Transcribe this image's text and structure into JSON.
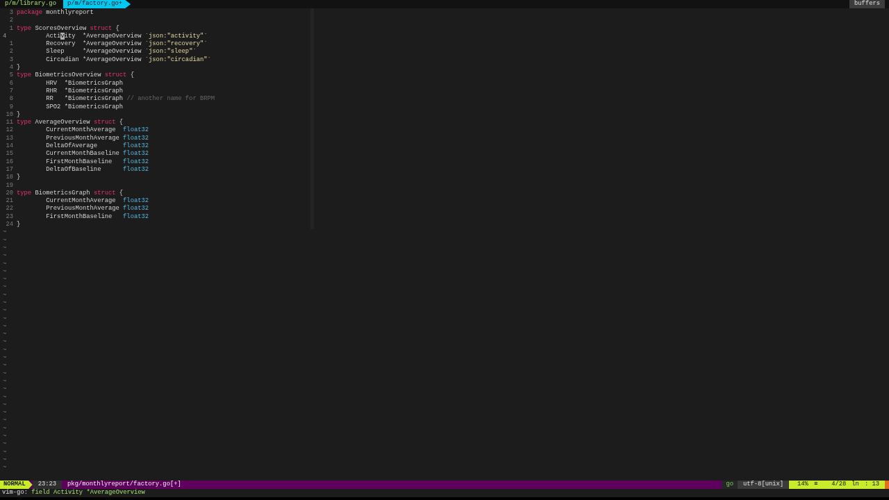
{
  "tabline": {
    "tabs": [
      {
        "label": "p/m/library.go",
        "selected": false
      },
      {
        "label": "p/m/factory.go+",
        "selected": true
      }
    ],
    "buffers_label": "buffers"
  },
  "lines": [
    {
      "number": "3",
      "current": false,
      "tokens": [
        {
          "kind": "keyword",
          "text": "package"
        },
        {
          "kind": "plain",
          "text": " monthlyreport"
        }
      ]
    },
    {
      "number": "2",
      "current": false
    },
    {
      "number": "1",
      "current": false,
      "tokens": [
        {
          "kind": "keyword",
          "text": "type"
        },
        {
          "kind": "plain",
          "text": " ScoresOverview "
        },
        {
          "kind": "keyword",
          "text": "struct"
        },
        {
          "kind": "plain",
          "text": " {"
        }
      ]
    },
    {
      "number": "4",
      "current": true,
      "tokens": [
        {
          "kind": "plain",
          "text": "\tActi"
        },
        {
          "kind": "cursor",
          "text": "v"
        },
        {
          "kind": "plain",
          "text": "ity  *AverageOverview "
        },
        {
          "kind": "string",
          "text": "`json:\"activity\"`"
        }
      ]
    },
    {
      "number": "1",
      "current": false,
      "tokens": [
        {
          "kind": "plain",
          "text": "\tRecovery  *AverageOverview "
        },
        {
          "kind": "string",
          "text": "`json:\"recovery\"`"
        }
      ]
    },
    {
      "number": "2",
      "current": false,
      "tokens": [
        {
          "kind": "plain",
          "text": "\tSleep     *AverageOverview "
        },
        {
          "kind": "string",
          "text": "`json:\"sleep\"`"
        }
      ]
    },
    {
      "number": "3",
      "current": false,
      "tokens": [
        {
          "kind": "plain",
          "text": "\tCircadian *AverageOverview "
        },
        {
          "kind": "string",
          "text": "`json:\"circadian\"`"
        }
      ]
    },
    {
      "number": "4",
      "current": false,
      "tokens": [
        {
          "kind": "plain",
          "text": "}"
        }
      ]
    },
    {
      "number": "5",
      "current": false,
      "tokens": [
        {
          "kind": "keyword",
          "text": "type"
        },
        {
          "kind": "plain",
          "text": " BiometricsOverview "
        },
        {
          "kind": "keyword",
          "text": "struct"
        },
        {
          "kind": "plain",
          "text": " {"
        }
      ]
    },
    {
      "number": "6",
      "current": false,
      "tokens": [
        {
          "kind": "plain",
          "text": "\tHRV  *BiometricsGraph"
        }
      ]
    },
    {
      "number": "7",
      "current": false,
      "tokens": [
        {
          "kind": "plain",
          "text": "\tRHR  *BiometricsGraph"
        }
      ]
    },
    {
      "number": "8",
      "current": false,
      "tokens": [
        {
          "kind": "plain",
          "text": "\tRR   *BiometricsGraph "
        },
        {
          "kind": "comment",
          "text": "// another name for BRPM"
        }
      ]
    },
    {
      "number": "9",
      "current": false,
      "tokens": [
        {
          "kind": "plain",
          "text": "\tSPO2 *BiometricsGraph"
        }
      ]
    },
    {
      "number": "10",
      "current": false,
      "tokens": [
        {
          "kind": "plain",
          "text": "}"
        }
      ]
    },
    {
      "number": "11",
      "current": false,
      "tokens": [
        {
          "kind": "keyword",
          "text": "type"
        },
        {
          "kind": "plain",
          "text": " AverageOverview "
        },
        {
          "kind": "keyword",
          "text": "struct"
        },
        {
          "kind": "plain",
          "text": " {"
        }
      ]
    },
    {
      "number": "12",
      "current": false,
      "tokens": [
        {
          "kind": "plain",
          "text": "\tCurrentMonthAverage  "
        },
        {
          "kind": "builtin",
          "text": "float32"
        }
      ]
    },
    {
      "number": "13",
      "current": false,
      "tokens": [
        {
          "kind": "plain",
          "text": "\tPreviousMonthAverage "
        },
        {
          "kind": "builtin",
          "text": "float32"
        }
      ]
    },
    {
      "number": "14",
      "current": false,
      "tokens": [
        {
          "kind": "plain",
          "text": "\tDeltaOfAverage       "
        },
        {
          "kind": "builtin",
          "text": "float32"
        }
      ]
    },
    {
      "number": "15",
      "current": false,
      "tokens": [
        {
          "kind": "plain",
          "text": "\tCurrentMonthBaseline "
        },
        {
          "kind": "builtin",
          "text": "float32"
        }
      ]
    },
    {
      "number": "16",
      "current": false,
      "tokens": [
        {
          "kind": "plain",
          "text": "\tFirstMonthBaseline   "
        },
        {
          "kind": "builtin",
          "text": "float32"
        }
      ]
    },
    {
      "number": "17",
      "current": false,
      "tokens": [
        {
          "kind": "plain",
          "text": "\tDeltaOfBaseline      "
        },
        {
          "kind": "builtin",
          "text": "float32"
        }
      ]
    },
    {
      "number": "18",
      "current": false,
      "tokens": [
        {
          "kind": "plain",
          "text": "}"
        }
      ]
    },
    {
      "number": "19",
      "current": false
    },
    {
      "number": "20",
      "current": false,
      "tokens": [
        {
          "kind": "keyword",
          "text": "type"
        },
        {
          "kind": "plain",
          "text": " BiometricsGraph "
        },
        {
          "kind": "keyword",
          "text": "struct"
        },
        {
          "kind": "plain",
          "text": " {"
        }
      ]
    },
    {
      "number": "21",
      "current": false,
      "tokens": [
        {
          "kind": "plain",
          "text": "\tCurrentMonthAverage  "
        },
        {
          "kind": "builtin",
          "text": "float32"
        }
      ]
    },
    {
      "number": "22",
      "current": false,
      "tokens": [
        {
          "kind": "plain",
          "text": "\tPreviousMonthAverage "
        },
        {
          "kind": "builtin",
          "text": "float32"
        }
      ]
    },
    {
      "number": "23",
      "current": false,
      "tokens": [
        {
          "kind": "plain",
          "text": "\tFirstMonthBaseline   "
        },
        {
          "kind": "builtin",
          "text": "float32"
        }
      ]
    },
    {
      "number": "24",
      "current": false,
      "tokens": [
        {
          "kind": "plain",
          "text": "}"
        }
      ]
    }
  ],
  "empty_line_markers": [
    "~",
    "~",
    "~",
    "~",
    "~",
    "~",
    "~",
    "~",
    "~",
    "~",
    "~",
    "~",
    "~",
    "~",
    "~",
    "~",
    "~",
    "~",
    "~",
    "~",
    "~",
    "~",
    "~",
    "~",
    "~",
    "~",
    "~",
    "~",
    "~",
    "~",
    "~"
  ],
  "status_bar": {
    "mode": "NORMAL",
    "time": "23:23",
    "file": "pkg/monthlyreport/factory.go[+]",
    "filetype": "go",
    "encoding": "utf-8[unix]",
    "percent": "14%",
    "percent_icon": "≡",
    "position": "4/28",
    "line_icon": "ln",
    "column": ": 13"
  },
  "command_line": {
    "prefix": "vim-go:",
    "message": " field Activity *AverageOverview"
  }
}
